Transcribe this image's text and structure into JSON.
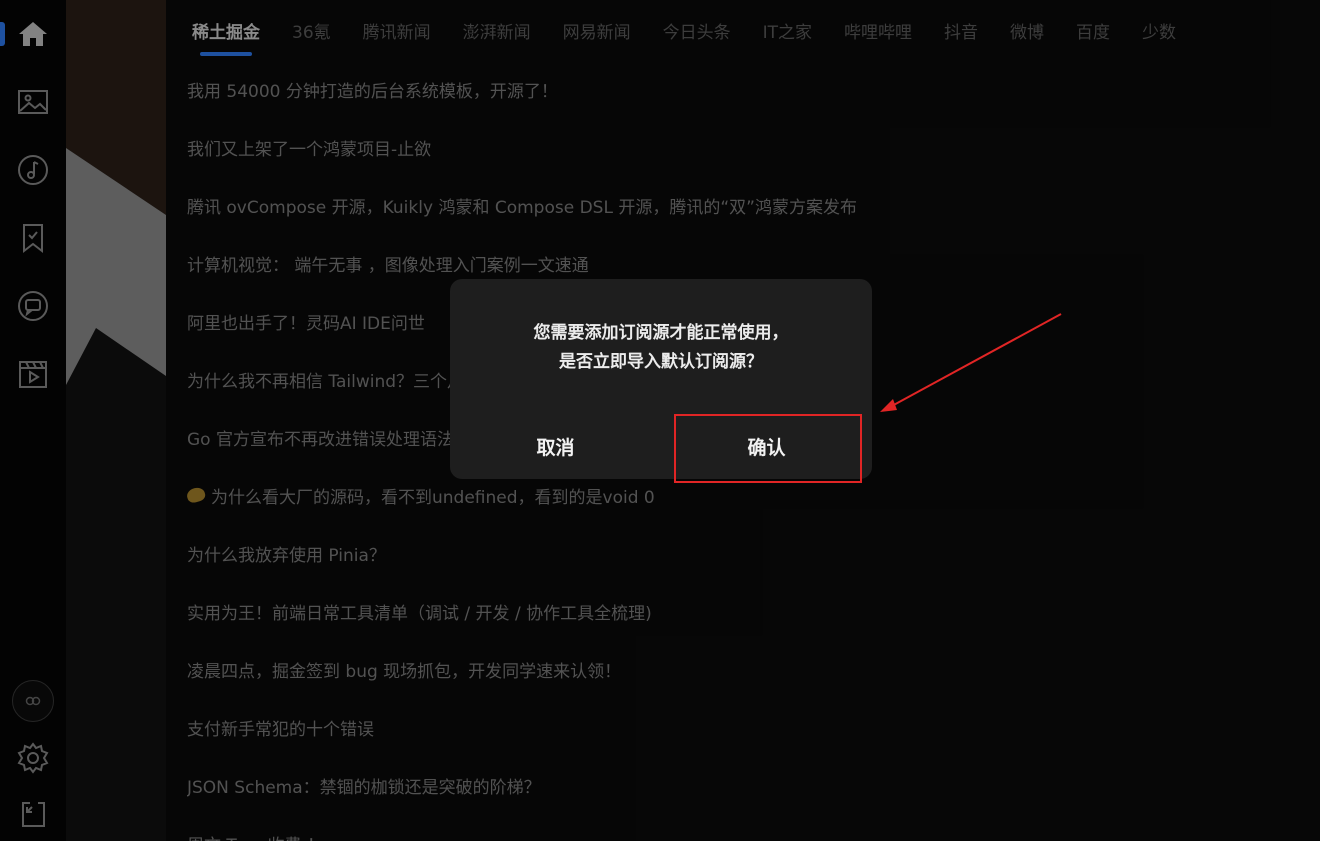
{
  "sidebar": {
    "items": [
      {
        "icon": "home-icon",
        "active": true
      },
      {
        "icon": "image-icon"
      },
      {
        "icon": "music-icon"
      },
      {
        "icon": "bookmark-icon"
      },
      {
        "icon": "chat-icon"
      },
      {
        "icon": "video-icon"
      }
    ],
    "bottom": [
      {
        "icon": "avatar-icon"
      },
      {
        "icon": "gear-icon"
      },
      {
        "icon": "export-icon"
      }
    ],
    "accent_color": "#2f7df6"
  },
  "tabs": [
    {
      "label": "稀土掘金",
      "active": true
    },
    {
      "label": "36氪"
    },
    {
      "label": "腾讯新闻"
    },
    {
      "label": "澎湃新闻"
    },
    {
      "label": "网易新闻"
    },
    {
      "label": "今日头条"
    },
    {
      "label": "IT之家"
    },
    {
      "label": "哔哩哔哩"
    },
    {
      "label": "抖音"
    },
    {
      "label": "微博"
    },
    {
      "label": "百度"
    },
    {
      "label": "少数"
    }
  ],
  "articles": [
    {
      "title": "我用 54000 分钟打造的后台系统模板，开源了！"
    },
    {
      "title": "我们又上架了一个鸿蒙项目-止欲"
    },
    {
      "title": "腾讯 ovCompose 开源，Kuikly 鸿蒙和 Compose DSL 开源，腾讯的“双”鸿蒙方案发布"
    },
    {
      "title": "计算机视觉： 端午无事 ，图像处理入门案例一文速通"
    },
    {
      "title": "阿里也出手了！灵码AI IDE问世"
    },
    {
      "title": "为什么我不再相信 Tailwind？三个月重构项目教会我的事"
    },
    {
      "title": "Go 官方宣布不再改进错误处理语法"
    },
    {
      "title": "为什么看大厂的源码，看不到undefined，看到的是void 0",
      "emoji": true
    },
    {
      "title": "为什么我放弃使用 Pinia？"
    },
    {
      "title": "实用为王！前端日常工具清单（调试 / 开发 / 协作工具全梳理)"
    },
    {
      "title": "凌晨四点，掘金签到 bug 现场抓包，开发同学速来认领！"
    },
    {
      "title": "支付新手常犯的十个错误"
    },
    {
      "title": "JSON Schema：禁锢的枷锁还是突破的阶梯？"
    },
    {
      "title": "周文 Trae 收费 ！"
    }
  ],
  "dialog": {
    "line1": "您需要添加订阅源才能正常使用，",
    "line2": "是否立即导入默认订阅源？",
    "cancel_label": "取消",
    "confirm_label": "确认"
  },
  "annotation": {
    "color": "#e12525"
  }
}
